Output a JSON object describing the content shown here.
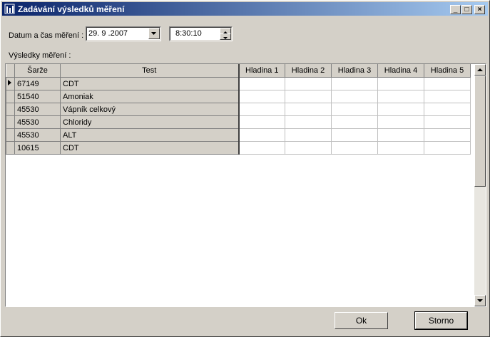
{
  "window": {
    "title": "Zadávání výsledků měření"
  },
  "form": {
    "datetime_label": "Datum a čas měření :",
    "date_value": "29. 9 .2007",
    "time_value": "8:30:10",
    "results_label": "Výsledky měření :"
  },
  "grid": {
    "columns": [
      "Šarže",
      "Test",
      "Hladina 1",
      "Hladina 2",
      "Hladina 3",
      "Hladina 4",
      "Hladina 5"
    ],
    "rows": [
      {
        "batch": "67149",
        "test": "CDT"
      },
      {
        "batch": "51540",
        "test": "Amoniak"
      },
      {
        "batch": "45530",
        "test": "Vápník celkový"
      },
      {
        "batch": "45530",
        "test": "Chloridy"
      },
      {
        "batch": "45530",
        "test": "ALT"
      },
      {
        "batch": "10615",
        "test": "CDT"
      }
    ]
  },
  "buttons": {
    "ok": "Ok",
    "cancel": "Storno"
  }
}
